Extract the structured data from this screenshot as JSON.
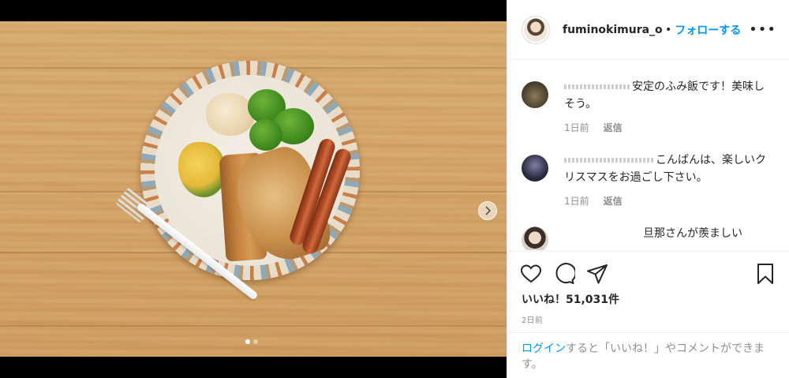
{
  "post": {
    "carousel": {
      "slide_count": 2,
      "active_index": 1
    }
  },
  "header": {
    "username": "fuminokimura_offi",
    "separator": "•",
    "follow_label": "フォローする",
    "more_label": "•••"
  },
  "comments": [
    {
      "text": "安定のふみ飯です！美味しそう。",
      "age": "1日前",
      "reply_label": "返信"
    },
    {
      "text": "こんばんは、楽しいクリスマスをお過ごし下さい。",
      "age": "1日前",
      "reply_label": "返信"
    },
    {
      "text": "旦那さんが羨ましい"
    }
  ],
  "actions": {
    "icons": [
      "heart-icon",
      "comment-icon",
      "share-icon",
      "bookmark-icon"
    ],
    "likes_label": "いいね！51,031件",
    "timestamp": "2日前"
  },
  "login_prompt": {
    "link": "ログイン",
    "text": "すると「いいね！」やコメントができます。"
  },
  "colors": {
    "accent": "#0095f6",
    "text": "#262626",
    "muted": "#8e8e8e",
    "divider": "#efefef"
  }
}
